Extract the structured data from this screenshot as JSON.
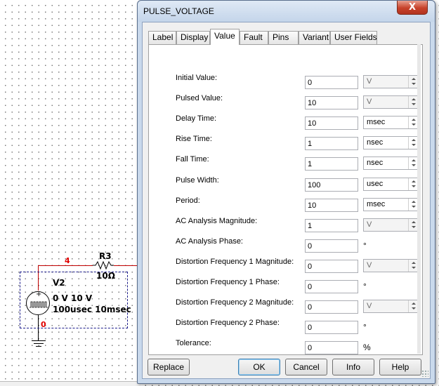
{
  "schematic": {
    "net_4": "4",
    "net_0": "0",
    "resistor": {
      "ref": "R3",
      "value": "10Ω"
    },
    "source": {
      "ref": "V2",
      "line1": "0 V 10 V",
      "line2": "100usec 10msec"
    }
  },
  "dialog": {
    "title": "PULSE_VOLTAGE",
    "close_glyph": "X",
    "tabs": [
      {
        "label": "Label",
        "active": false
      },
      {
        "label": "Display",
        "active": false
      },
      {
        "label": "Value",
        "active": true
      },
      {
        "label": "Fault",
        "active": false
      },
      {
        "label": "Pins",
        "active": false
      },
      {
        "label": "Variant",
        "active": false
      },
      {
        "label": "User Fields",
        "active": false
      }
    ],
    "rows": [
      {
        "label": "Initial Value:",
        "value": "0",
        "unit": "V",
        "unit_kind": "disabled"
      },
      {
        "label": "Pulsed Value:",
        "value": "10",
        "unit": "V",
        "unit_kind": "disabled"
      },
      {
        "label": "Delay Time:",
        "value": "10",
        "unit": "msec",
        "unit_kind": "spinner"
      },
      {
        "label": "Rise Time:",
        "value": "1",
        "unit": "nsec",
        "unit_kind": "spinner"
      },
      {
        "label": "Fall Time:",
        "value": "1",
        "unit": "nsec",
        "unit_kind": "spinner"
      },
      {
        "label": "Pulse Width:",
        "value": "100",
        "unit": "usec",
        "unit_kind": "spinner"
      },
      {
        "label": "Period:",
        "value": "10",
        "unit": "msec",
        "unit_kind": "spinner"
      },
      {
        "label": "AC Analysis Magnitude:",
        "value": "1",
        "unit": "V",
        "unit_kind": "disabled"
      },
      {
        "label": "AC Analysis Phase:",
        "value": "0",
        "unit": "°",
        "unit_kind": "plain"
      },
      {
        "label": "Distortion Frequency 1 Magnitude:",
        "value": "0",
        "unit": "V",
        "unit_kind": "disabled"
      },
      {
        "label": "Distortion Frequency 1 Phase:",
        "value": "0",
        "unit": "°",
        "unit_kind": "plain"
      },
      {
        "label": "Distortion Frequency 2 Magnitude:",
        "value": "0",
        "unit": "V",
        "unit_kind": "disabled"
      },
      {
        "label": "Distortion Frequency 2 Phase:",
        "value": "0",
        "unit": "°",
        "unit_kind": "plain"
      },
      {
        "label": "Tolerance:",
        "value": "0",
        "unit": "%",
        "unit_kind": "plain"
      }
    ],
    "buttons": {
      "replace": "Replace",
      "ok": "OK",
      "cancel": "Cancel",
      "info": "Info",
      "help": "Help"
    }
  }
}
